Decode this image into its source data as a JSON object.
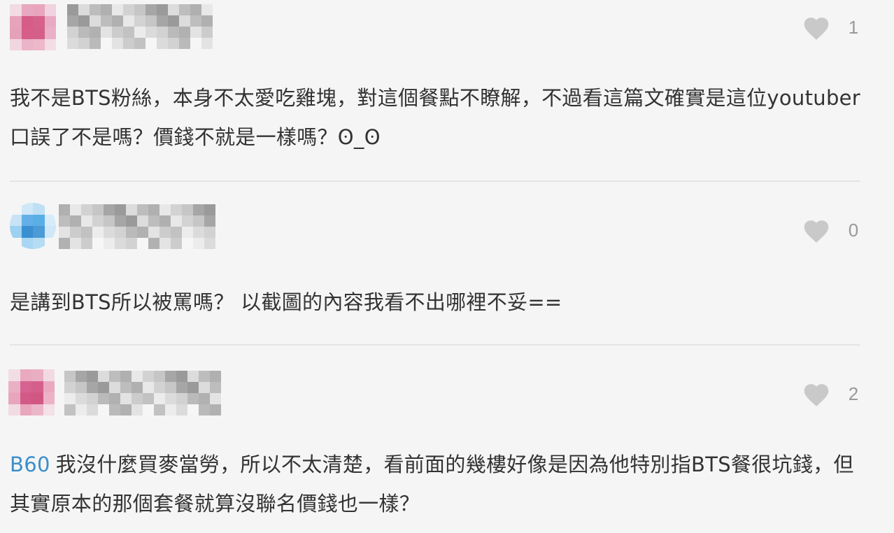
{
  "comments": [
    {
      "avatar_colors": [
        "#f2dbe3",
        "#e8a8bf",
        "#e9a5bd",
        "#f0d3de",
        "#e7a3bb",
        "#d45c86",
        "#d6628b",
        "#e8abc1",
        "#e6a1ba",
        "#d55d87",
        "#d4608a",
        "#eab0c5",
        "#f1d6e0",
        "#ebb4c8",
        "#ecb8ca",
        "#f3dde5"
      ],
      "like_count": "1",
      "text": "我不是BTS粉絲，本身不太愛吃雞塊，對這個餐點不瞭解，不過看這篇文確實是這位youtuber口誤了不是嗎？價錢不就是一樣嗎？ʘ_ʘ"
    },
    {
      "avatar_colors": [
        "#f5f5f5",
        "#cfe7f6",
        "#bfdff4",
        "#f5f5f5",
        "#c7e3f5",
        "#63b0e6",
        "#5aaee6",
        "#d7ecf8",
        "#9dd0f1",
        "#3a8fd0",
        "#4c9ad6",
        "#cfe7f6",
        "#f5f5f5",
        "#a9d6f2",
        "#b6dcf3",
        "#f5f5f5"
      ],
      "like_count": "0",
      "text": "是講到BTS所以被罵嗎？ 以截圖的內容我看不出哪裡不妥=="
    },
    {
      "avatar_colors": [
        "#f3dde5",
        "#e9a9bf",
        "#eaaec3",
        "#f2d9e2",
        "#eab0c4",
        "#d66390",
        "#d55f8b",
        "#eba9c0",
        "#e8a5bc",
        "#d35a86",
        "#d15783",
        "#ecb3c6",
        "#f3dbe3",
        "#e9a7be",
        "#ecb6c9",
        "#f4e0e7"
      ],
      "like_count": "2",
      "mention": "B60",
      "text": "我沒什麼買麥當勞，所以不太清楚，看前面的幾樓好像是因為他特別指BTS餐很坑錢，但其實原本的那個套餐就算沒聯名價錢也一樣？"
    }
  ]
}
